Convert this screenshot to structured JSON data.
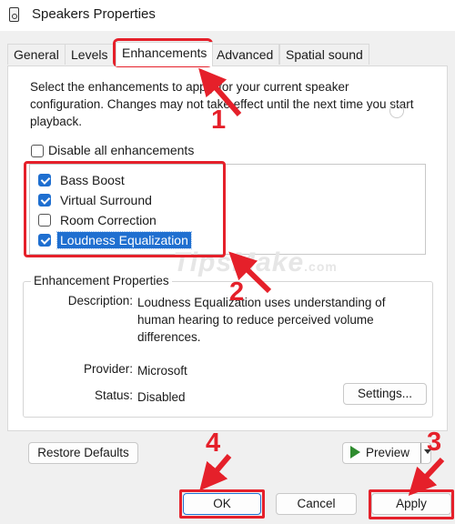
{
  "window": {
    "title": "Speakers Properties"
  },
  "tabs": [
    {
      "label": "General"
    },
    {
      "label": "Levels"
    },
    {
      "label": "Enhancements"
    },
    {
      "label": "Advanced"
    },
    {
      "label": "Spatial sound"
    }
  ],
  "enhancements": {
    "description": "Select the enhancements to apply for your current speaker configuration. Changes may not take effect until the next time you start playback.",
    "disable_all": {
      "label": "Disable all enhancements",
      "checked": false
    },
    "items": [
      {
        "label": "Bass Boost",
        "checked": true
      },
      {
        "label": "Virtual Surround",
        "checked": true
      },
      {
        "label": "Room Correction",
        "checked": false
      },
      {
        "label": "Loudness Equalization",
        "checked": true,
        "selected": true
      }
    ]
  },
  "properties": {
    "group_title": "Enhancement Properties",
    "description_label": "Description:",
    "description_value": "Loudness Equalization uses understanding of human hearing to reduce perceived volume differences.",
    "provider_label": "Provider:",
    "provider_value": "Microsoft",
    "status_label": "Status:",
    "status_value": "Disabled",
    "settings_button": "Settings..."
  },
  "buttons": {
    "restore_defaults": "Restore Defaults",
    "preview": "Preview",
    "ok": "OK",
    "cancel": "Cancel",
    "apply": "Apply"
  },
  "annotations": {
    "step1": "1",
    "step2": "2",
    "step3": "3",
    "step4": "4",
    "highlight_color": "#e5202a"
  },
  "watermark": {
    "text": "TipsMake",
    "suffix": ".com"
  },
  "colors": {
    "accent": "#1f6fd0",
    "preview_arrow": "#2e8b2e"
  }
}
